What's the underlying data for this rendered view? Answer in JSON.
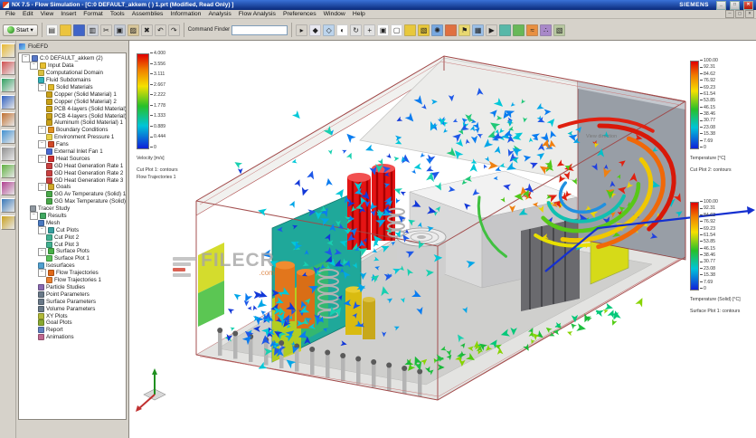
{
  "window": {
    "title": "NX 7.5 - Flow Simulation - [C:0 DEFAULT_akkem ( ) 1.prt (Modified, Read Only) ]",
    "brand": "SIEMENS",
    "buttons": {
      "minimize": "_",
      "maximize": "□",
      "close": "✕"
    }
  },
  "menubar": {
    "items": [
      "File",
      "Edit",
      "View",
      "Insert",
      "Format",
      "Tools",
      "Assemblies",
      "Information",
      "Analysis",
      "Flow Analysis",
      "Preferences",
      "Window",
      "Help"
    ]
  },
  "toolbar": {
    "start_label": "Start ▾",
    "command_finder_label": "Command Finder",
    "command_finder_value": "",
    "icons": [
      {
        "name": "new-file-icon",
        "color": "#f6f6f4",
        "char": "▤"
      },
      {
        "name": "open-folder-icon",
        "color": "#ecc43e",
        "char": ""
      },
      {
        "name": "save-icon",
        "color": "#4064c8",
        "char": ""
      },
      {
        "name": "export-icon",
        "color": "#cfd3db",
        "char": "▥"
      },
      {
        "name": "cut-icon",
        "color": "#d6d2ca",
        "char": "✂"
      },
      {
        "name": "copy-icon",
        "color": "#c6ccd6",
        "char": "▣"
      },
      {
        "name": "paste-icon",
        "color": "#d9c79a",
        "char": "▨"
      },
      {
        "name": "delete-icon",
        "color": "#d6d2ca",
        "char": "✖"
      },
      {
        "name": "undo-icon",
        "color": "#d6d2ca",
        "char": "↶"
      },
      {
        "name": "redo-icon",
        "color": "#d6d2ca",
        "char": "↷"
      },
      {
        "name": "selection-filter-icon",
        "color": "#d6d2ca",
        "char": "▸"
      },
      {
        "name": "snap-point-icon",
        "color": "#e8e8f0",
        "char": "◆"
      },
      {
        "name": "datum-plane-icon",
        "color": "#bcd4ec",
        "char": "◇"
      },
      {
        "name": "shaded-view-icon",
        "color": "#ffffff",
        "char": "◐"
      },
      {
        "name": "rotate-view-icon",
        "color": "#e2e2e2",
        "char": "↻"
      },
      {
        "name": "pan-view-icon",
        "color": "#e2e2e2",
        "char": "+"
      },
      {
        "name": "fit-view-icon",
        "color": "#ffffff",
        "char": "▣"
      },
      {
        "name": "window-icon",
        "color": "#ffffff",
        "char": "▢"
      },
      {
        "name": "computational-domain-icon",
        "color": "#e8c83c",
        "char": ""
      },
      {
        "name": "boundary-condition-icon",
        "color": "#e8c83c",
        "char": "▧"
      },
      {
        "name": "fan-icon",
        "color": "#78a8e0",
        "char": "✺"
      },
      {
        "name": "heat-source-icon",
        "color": "#e07040",
        "char": ""
      },
      {
        "name": "goal-icon",
        "color": "#e8d870",
        "char": "⚑"
      },
      {
        "name": "mesh-icon",
        "color": "#9cc0e8",
        "char": "▦"
      },
      {
        "name": "run-solver-icon",
        "color": "#d6d2ca",
        "char": "▶"
      },
      {
        "name": "cut-plot-icon",
        "color": "#58b8a8",
        "char": ""
      },
      {
        "name": "surface-plot-icon",
        "color": "#68b858",
        "char": ""
      },
      {
        "name": "flow-trajectories-icon",
        "color": "#e89040",
        "char": "≈"
      },
      {
        "name": "particle-study-icon",
        "color": "#a888c8",
        "char": "∴"
      },
      {
        "name": "results-icon",
        "color": "#b8c8a0",
        "char": "▧"
      }
    ]
  },
  "resource_bar": {
    "icons": [
      {
        "name": "assembly-navigator-icon",
        "color": "#e8b830"
      },
      {
        "name": "constraint-navigator-icon",
        "color": "#d05050"
      },
      {
        "name": "part-navigator-icon",
        "color": "#30a060"
      },
      {
        "name": "reuse-library-icon",
        "color": "#3060c0"
      },
      {
        "name": "hd3d-tools-icon",
        "color": "#c07030"
      },
      {
        "name": "web-browser-icon",
        "color": "#4090d0"
      },
      {
        "name": "history-icon",
        "color": "#909090"
      },
      {
        "name": "process-studio-icon",
        "color": "#60b040"
      },
      {
        "name": "manufacturing-wizard-icon",
        "color": "#b04090"
      },
      {
        "name": "roles-icon",
        "color": "#3878b8"
      },
      {
        "name": "system-scenes-icon",
        "color": "#c8a020"
      }
    ]
  },
  "tree": {
    "header": "FloEFD",
    "items": [
      {
        "t": "C:0 DEFAULT_akkem (2)",
        "d": 0,
        "i": "part-icon",
        "c": "#5878c8",
        "e": true
      },
      {
        "t": "Input Data",
        "d": 1,
        "i": "input-data-folder-icon",
        "c": "#e8c030",
        "e": true
      },
      {
        "t": "Computational Domain",
        "d": 2,
        "i": "computational-domain-icon",
        "c": "#d8c040",
        "e": false
      },
      {
        "t": "Fluid Subdomains",
        "d": 2,
        "i": "fluid-subdomains-icon",
        "c": "#30b0b8",
        "e": false
      },
      {
        "t": "Solid Materials",
        "d": 2,
        "i": "solid-materials-folder-icon",
        "c": "#e0b828",
        "e": true
      },
      {
        "t": "Copper (Solid Material) 1",
        "d": 3,
        "i": "solid-material-icon",
        "c": "#c8a018",
        "e": false
      },
      {
        "t": "Copper (Solid Material) 2",
        "d": 3,
        "i": "solid-material-icon",
        "c": "#c8a018",
        "e": false
      },
      {
        "t": "PCB 4-layers (Solid Material) 1",
        "d": 3,
        "i": "solid-material-icon",
        "c": "#c8a018",
        "e": false
      },
      {
        "t": "PCB 4-layers (Solid Material) 2",
        "d": 3,
        "i": "solid-material-icon",
        "c": "#c8a018",
        "e": false
      },
      {
        "t": "Aluminum (Solid Material) 1",
        "d": 3,
        "i": "solid-material-icon",
        "c": "#c8a018",
        "e": false
      },
      {
        "t": "Boundary Conditions",
        "d": 2,
        "i": "boundary-conditions-folder-icon",
        "c": "#e09020",
        "e": true
      },
      {
        "t": "Environment Pressure 1",
        "d": 3,
        "i": "environment-pressure-icon",
        "c": "#e8d048",
        "e": false
      },
      {
        "t": "Fans",
        "d": 2,
        "i": "fans-folder-icon",
        "c": "#d04828",
        "e": true
      },
      {
        "t": "External Inlet Fan 1",
        "d": 3,
        "i": "external-inlet-fan-icon",
        "c": "#4868d0",
        "e": false
      },
      {
        "t": "Heat Sources",
        "d": 2,
        "i": "heat-sources-folder-icon",
        "c": "#d03030",
        "e": true
      },
      {
        "t": "GD Heat Generation Rate 1",
        "d": 3,
        "i": "heat-generation-rate-icon",
        "c": "#c84040",
        "e": false
      },
      {
        "t": "GD Heat Generation Rate 2",
        "d": 3,
        "i": "heat-generation-rate-icon",
        "c": "#c84040",
        "e": false
      },
      {
        "t": "GD Heat Generation Rate 3",
        "d": 3,
        "i": "heat-generation-rate-icon",
        "c": "#c84040",
        "e": false
      },
      {
        "t": "Goals",
        "d": 2,
        "i": "goals-folder-icon",
        "c": "#d0a828",
        "e": true
      },
      {
        "t": "GG Av Temperature (Solid) 1",
        "d": 3,
        "i": "goal-icon",
        "c": "#48a848",
        "e": false
      },
      {
        "t": "GG Max Temperature (Solid) 1",
        "d": 3,
        "i": "goal-icon",
        "c": "#48a848",
        "e": false
      },
      {
        "t": "Tracer Study",
        "d": 1,
        "i": "tracer-study-icon",
        "c": "#9098a0",
        "e": false
      },
      {
        "t": "Results",
        "d": 1,
        "i": "results-folder-icon",
        "c": "#40a860",
        "e": true
      },
      {
        "t": "Mesh",
        "d": 2,
        "i": "mesh-icon",
        "c": "#4878c0",
        "e": false
      },
      {
        "t": "Cut Plots",
        "d": 2,
        "i": "cut-plots-folder-icon",
        "c": "#38a0a0",
        "e": true
      },
      {
        "t": "Cut Plot 2",
        "d": 3,
        "i": "cut-plot-icon",
        "c": "#40b090",
        "e": false
      },
      {
        "t": "Cut Plot 3",
        "d": 3,
        "i": "cut-plot-icon",
        "c": "#40b090",
        "e": false
      },
      {
        "t": "Surface Plots",
        "d": 2,
        "i": "surface-plots-folder-icon",
        "c": "#48b048",
        "e": true
      },
      {
        "t": "Surface Plot 1",
        "d": 3,
        "i": "surface-plot-icon",
        "c": "#58c058",
        "e": false
      },
      {
        "t": "Isosurfaces",
        "d": 2,
        "i": "isosurfaces-icon",
        "c": "#50a0d0",
        "e": false
      },
      {
        "t": "Flow Trajectories",
        "d": 2,
        "i": "flow-trajectories-folder-icon",
        "c": "#e06818",
        "e": true
      },
      {
        "t": "Flow Trajectories 1",
        "d": 3,
        "i": "flow-trajectory-icon",
        "c": "#e88030",
        "e": false
      },
      {
        "t": "Particle Studies",
        "d": 2,
        "i": "particle-studies-icon",
        "c": "#8868b0",
        "e": false
      },
      {
        "t": "Point Parameters",
        "d": 2,
        "i": "point-parameters-icon",
        "c": "#687888",
        "e": false
      },
      {
        "t": "Surface Parameters",
        "d": 2,
        "i": "surface-parameters-icon",
        "c": "#687888",
        "e": false
      },
      {
        "t": "Volume Parameters",
        "d": 2,
        "i": "volume-parameters-icon",
        "c": "#687888",
        "e": false
      },
      {
        "t": "XY Plots",
        "d": 2,
        "i": "xy-plots-icon",
        "c": "#b0b838",
        "e": false
      },
      {
        "t": "Goal Plots",
        "d": 2,
        "i": "goal-plots-icon",
        "c": "#88a830",
        "e": false
      },
      {
        "t": "Report",
        "d": 2,
        "i": "report-icon",
        "c": "#6080c0",
        "e": false
      },
      {
        "t": "Animations",
        "d": 2,
        "i": "animations-icon",
        "c": "#c06890",
        "e": false
      }
    ]
  },
  "viewport": {
    "watermark": {
      "text": "FILECR",
      "suffix": ".com"
    },
    "annotation": "View direction",
    "legends": [
      {
        "id": "legend-velocity",
        "title": "Velocity [m/s]",
        "subtitles": [
          "Cut Plot 1: contours",
          "Flow Trajectories 1"
        ],
        "values": [
          "4.000",
          "3.556",
          "3.111",
          "2.667",
          "2.222",
          "1.778",
          "1.333",
          "0.889",
          "0.444",
          "0"
        ]
      },
      {
        "id": "legend-temperature-fluid",
        "title": "Temperature [°C]",
        "subtitles": [
          "Cut Plot 2: contours"
        ],
        "values": [
          "100.00",
          "92.31",
          "84.62",
          "76.92",
          "69.23",
          "61.54",
          "53.85",
          "46.15",
          "38.46",
          "30.77",
          "23.08",
          "15.38",
          "7.69",
          "0"
        ]
      },
      {
        "id": "legend-temperature-solid",
        "title": "Temperature (Solid) [°C]",
        "subtitles": [
          "Surface Plot 1: contours"
        ],
        "values": [
          "100.00",
          "92.31",
          "84.62",
          "76.92",
          "69.23",
          "61.54",
          "53.85",
          "46.15",
          "38.46",
          "30.77",
          "23.08",
          "15.38",
          "7.69",
          "0"
        ]
      }
    ]
  }
}
